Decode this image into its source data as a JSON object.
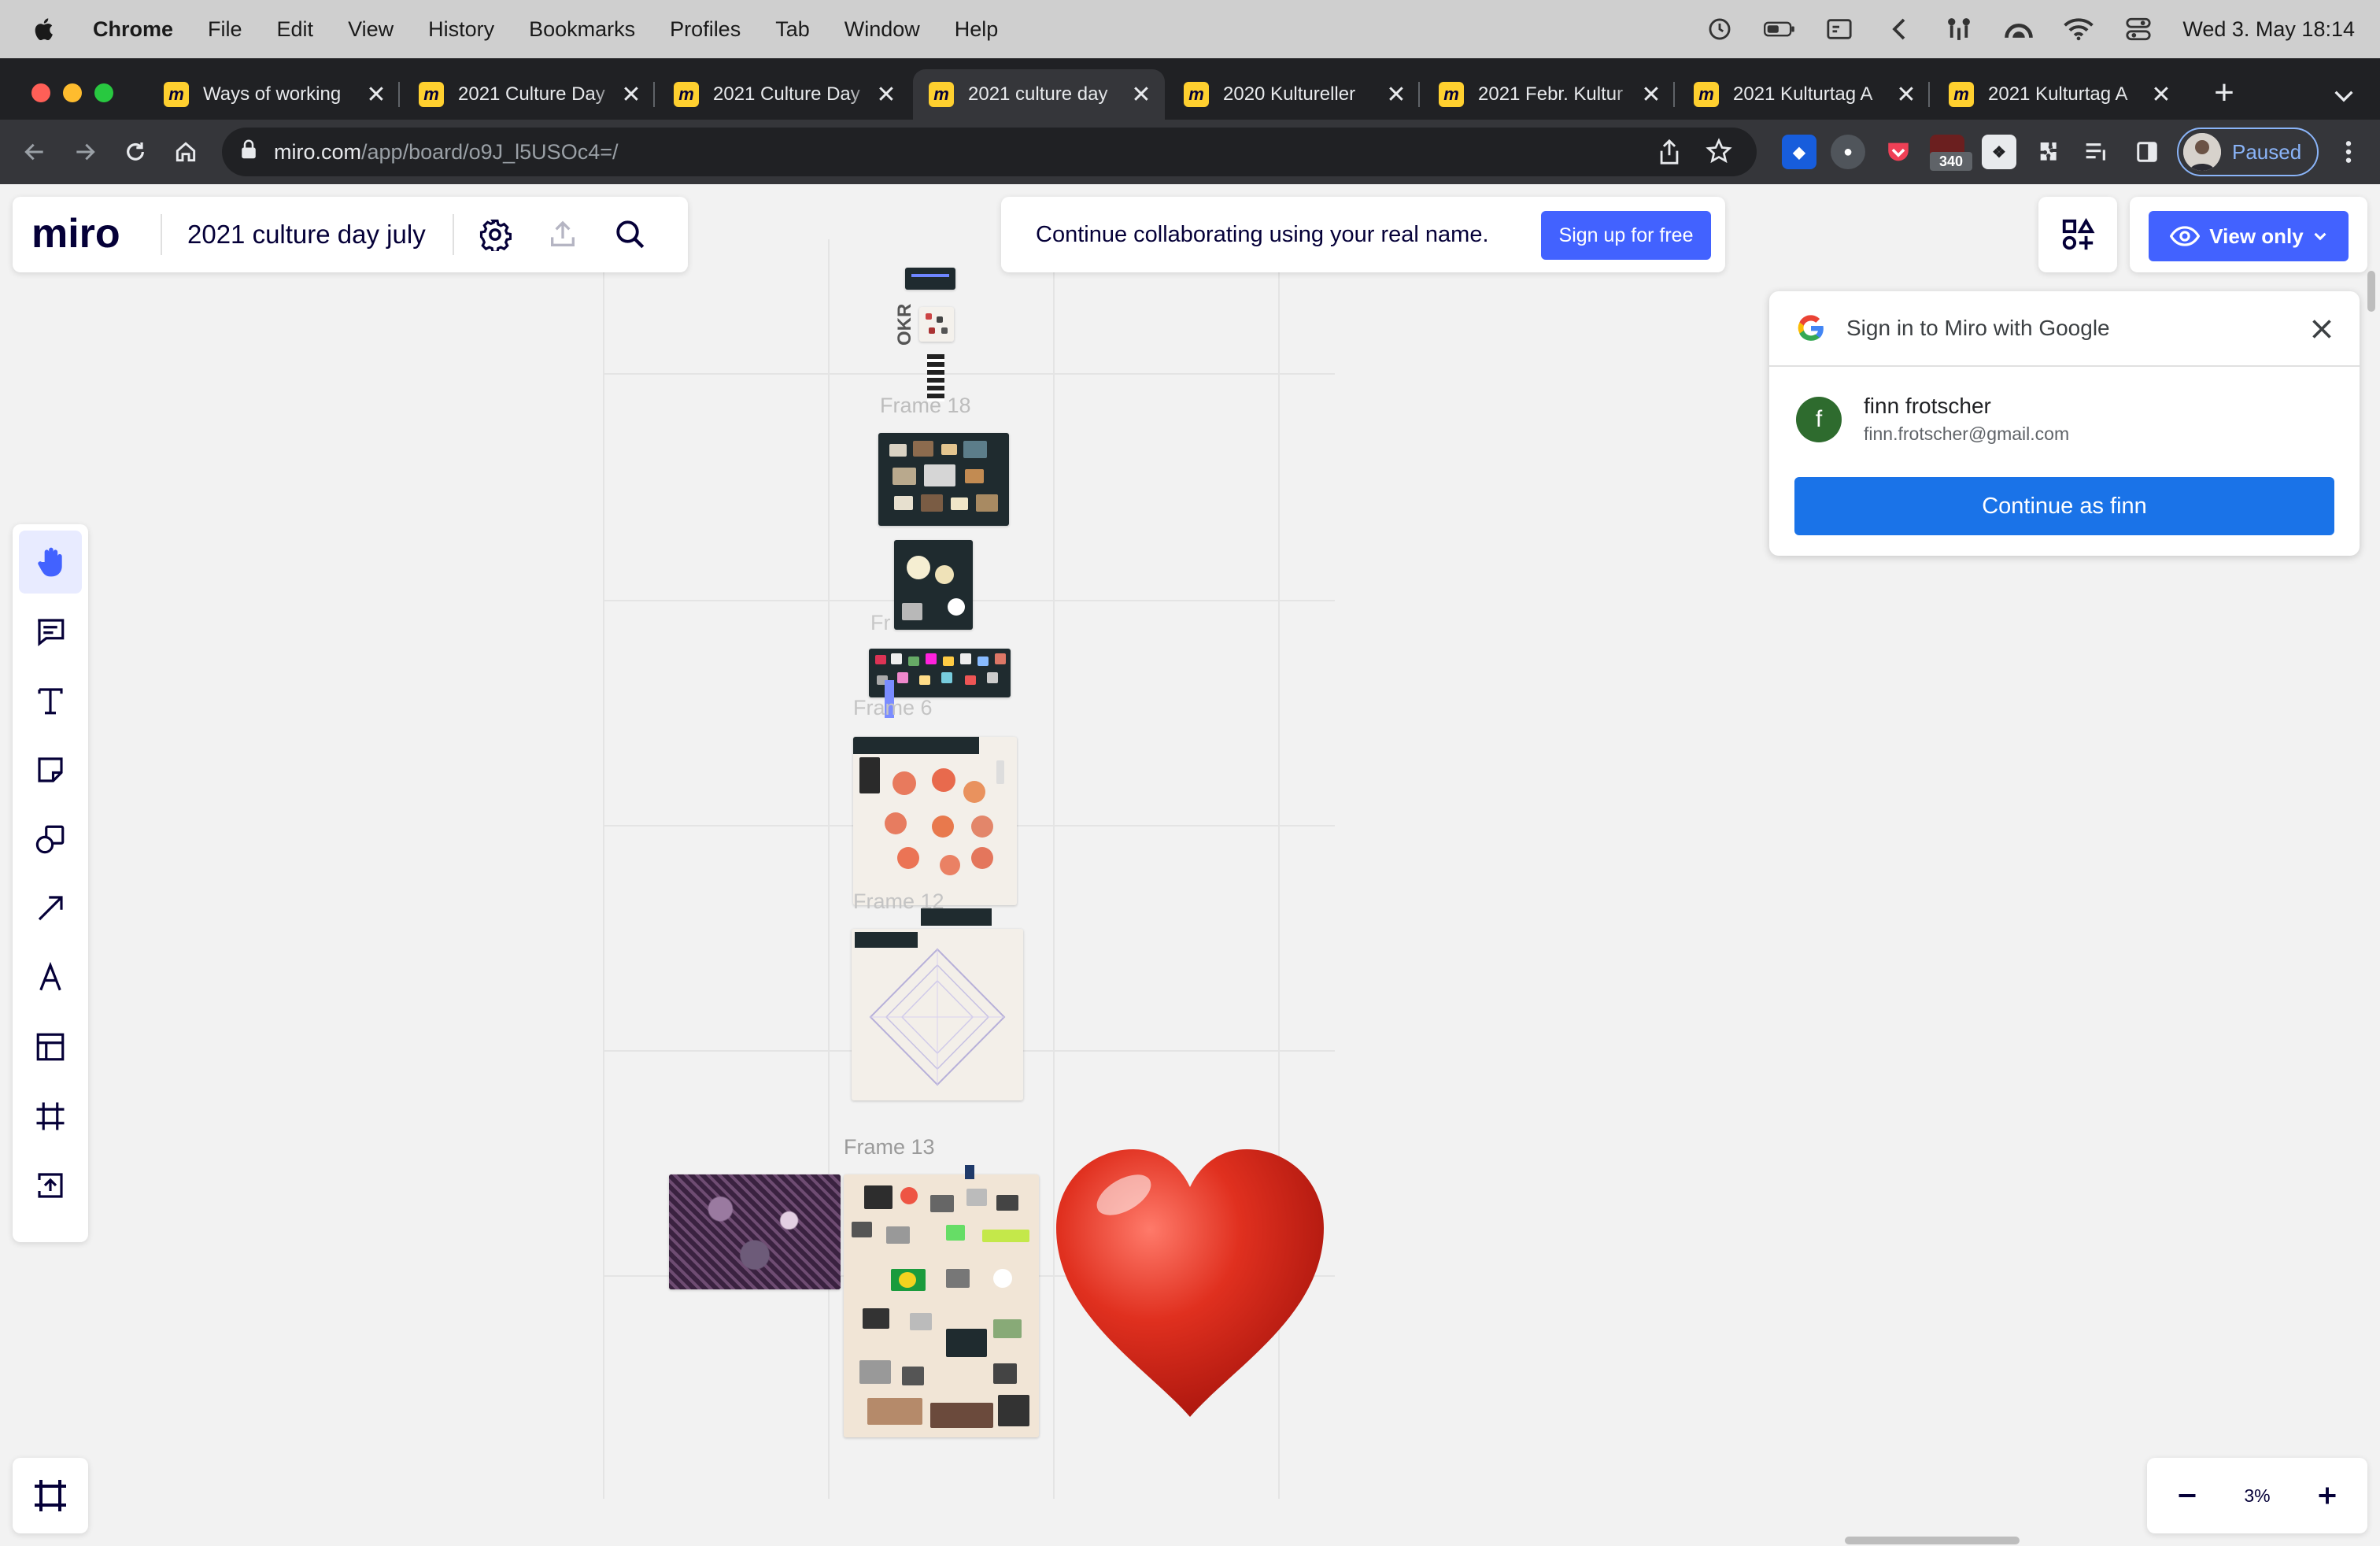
{
  "menubar": {
    "app": "Chrome",
    "items": [
      "File",
      "Edit",
      "View",
      "History",
      "Bookmarks",
      "Profiles",
      "Tab",
      "Window",
      "Help"
    ],
    "clock": "Wed 3. May  18:14"
  },
  "tabs": [
    {
      "title": "Ways of working",
      "active": false
    },
    {
      "title": "2021 Culture Day",
      "active": false
    },
    {
      "title": "2021 Culture Day",
      "active": false
    },
    {
      "title": "2021 culture day",
      "active": true
    },
    {
      "title": "2020 Kultureller",
      "active": false
    },
    {
      "title": "2021 Febr. Kultur",
      "active": false
    },
    {
      "title": "2021 Kulturtag A",
      "active": false
    },
    {
      "title": "2021 Kulturtag A",
      "active": false
    }
  ],
  "tab_icon": "miro-favicon",
  "address": {
    "host": "miro.com",
    "path": "/app/board/o9J_l5USOc4=/"
  },
  "extensions": {
    "badge": "340"
  },
  "profile": {
    "label": "Paused"
  },
  "miro": {
    "logo": "miro",
    "board_name": "2021 culture day july",
    "collab_message": "Continue collaborating using your real name.",
    "signup_label": "Sign up for free",
    "view_only_label": "View only",
    "zoom": "3%"
  },
  "google_prompt": {
    "title": "Sign in to Miro with Google",
    "avatar_letter": "f",
    "name": "finn frotscher",
    "email": "finn.frotscher@gmail.com",
    "continue_label": "Continue as finn"
  },
  "tools": [
    "hand",
    "comment",
    "text",
    "sticky-note",
    "shapes",
    "arrow",
    "pen",
    "templates",
    "frame",
    "upload"
  ],
  "frames": {
    "okr": "OKR",
    "frame18": "Frame 18",
    "frame_fr": "Fr",
    "frame6": "Frame 6",
    "frame12": "Frame 12",
    "frame13": "Frame 13"
  },
  "colors": {
    "miro_blue": "#4262ff",
    "google_blue": "#1a73e8",
    "heart": "#d9281f",
    "miro_yellow": "#ffd02f"
  }
}
